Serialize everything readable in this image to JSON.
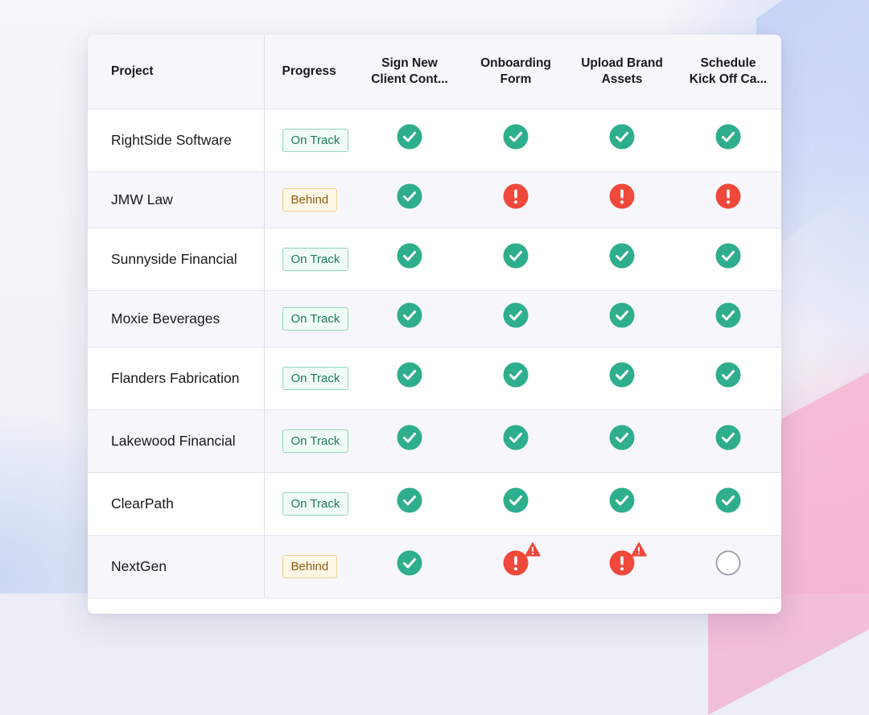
{
  "colors": {
    "complete": "#2eae8c",
    "overdue": "#f0493c",
    "pending": "#9a9aa2",
    "on_track": "#1f7a5c",
    "behind": "#8a5a12"
  },
  "icons": {
    "complete": "check-circle-icon",
    "overdue": "exclamation-circle-icon",
    "pending": "empty-circle-icon",
    "warning": "warning-triangle-icon"
  },
  "table": {
    "headers": {
      "project": "Project",
      "progress": "Progress",
      "steps": [
        "Sign New Client Cont...",
        "Onboarding Form",
        "Upload Brand Assets",
        "Schedule Kick Off Ca..."
      ]
    },
    "rows": [
      {
        "project": "RightSide Software",
        "progress": "On Track",
        "progress_type": "on-track",
        "steps": [
          "complete",
          "complete",
          "complete",
          "complete"
        ],
        "warnings": [
          false,
          false,
          false,
          false
        ]
      },
      {
        "project": "JMW Law",
        "progress": "Behind",
        "progress_type": "behind",
        "steps": [
          "complete",
          "overdue",
          "overdue",
          "overdue"
        ],
        "warnings": [
          false,
          false,
          false,
          false
        ]
      },
      {
        "project": "Sunnyside Financial",
        "progress": "On Track",
        "progress_type": "on-track",
        "steps": [
          "complete",
          "complete",
          "complete",
          "complete"
        ],
        "warnings": [
          false,
          false,
          false,
          false
        ]
      },
      {
        "project": "Moxie Beverages",
        "progress": "On Track",
        "progress_type": "on-track",
        "steps": [
          "complete",
          "complete",
          "complete",
          "complete"
        ],
        "warnings": [
          false,
          false,
          false,
          false
        ]
      },
      {
        "project": "Flanders Fabrication",
        "progress": "On Track",
        "progress_type": "on-track",
        "steps": [
          "complete",
          "complete",
          "complete",
          "complete"
        ],
        "warnings": [
          false,
          false,
          false,
          false
        ]
      },
      {
        "project": "Lakewood Financial",
        "progress": "On Track",
        "progress_type": "on-track",
        "steps": [
          "complete",
          "complete",
          "complete",
          "complete"
        ],
        "warnings": [
          false,
          false,
          false,
          false
        ]
      },
      {
        "project": "ClearPath",
        "progress": "On Track",
        "progress_type": "on-track",
        "steps": [
          "complete",
          "complete",
          "complete",
          "complete"
        ],
        "warnings": [
          false,
          false,
          false,
          false
        ]
      },
      {
        "project": "NextGen",
        "progress": "Behind",
        "progress_type": "behind",
        "steps": [
          "complete",
          "overdue",
          "overdue",
          "pending"
        ],
        "warnings": [
          false,
          true,
          true,
          false
        ]
      }
    ]
  }
}
